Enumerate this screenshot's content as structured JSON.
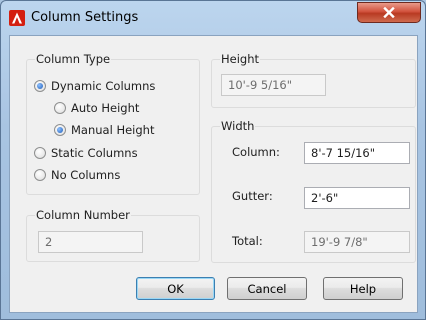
{
  "window": {
    "title": "Column Settings",
    "accent": "#d41f10"
  },
  "column_type": {
    "title": "Column Type",
    "options": [
      {
        "label": "Dynamic Columns",
        "checked": true
      },
      {
        "label": "Auto Height",
        "checked": false
      },
      {
        "label": "Manual Height",
        "checked": true
      },
      {
        "label": "Static Columns",
        "checked": false
      },
      {
        "label": "No Columns",
        "checked": false
      }
    ]
  },
  "column_number": {
    "title": "Column Number",
    "value": "2"
  },
  "height": {
    "title": "Height",
    "value": "10'-9 5/16\""
  },
  "width": {
    "title": "Width",
    "column_label": "Column:",
    "column_value": "8'-7 15/16\"",
    "gutter_label": "Gutter:",
    "gutter_value": "2'-6\"",
    "total_label": "Total:",
    "total_value": "19'-9 7/8\""
  },
  "buttons": {
    "ok": "OK",
    "cancel": "Cancel",
    "help": "Help"
  }
}
